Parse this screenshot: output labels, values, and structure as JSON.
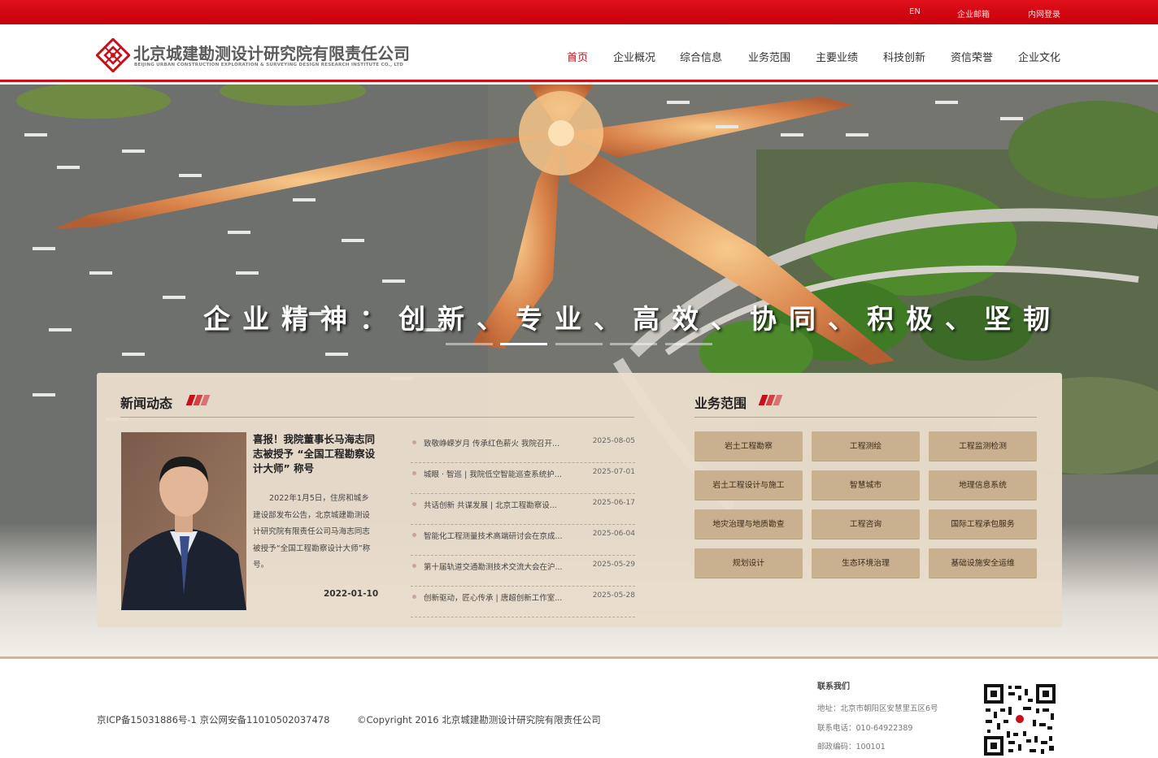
{
  "topbar": {
    "links": [
      "EN",
      "企业邮箱",
      "内网登录"
    ]
  },
  "header": {
    "logo_cn": "北京城建勘测设计研究院有限责任公司",
    "logo_en": "BEIJING URBAN CONSTRUCTION EXPLORATION & SURVEYING DESIGN RESEARCH INSTITUTE CO., LTD",
    "nav": [
      "首页",
      "企业概况",
      "综合信息",
      "业务范围",
      "主要业绩",
      "科技创新",
      "资信荣誉",
      "企业文化"
    ],
    "active_nav": "首页"
  },
  "banner": {
    "slogan": "企业精神：创新、专业、高效、协同、积极、坚韧",
    "slides_total": 5,
    "active_slide": 2
  },
  "news": {
    "title": "新闻动态",
    "featured": {
      "title": "喜报！我院董事长马海志同志被授予 “全国工程勘察设计大师” 称号",
      "body": "2022年1月5日，住房和城乡建设部发布公告，北京城建勘测设计研究院有限责任公司马海志同志被授予“全国工程勘察设计大师”称号。",
      "date": "2022-01-10"
    },
    "items": [
      {
        "text": "致敬峥嵘岁月 传承红色薪火 我院召开...",
        "date": "2025-08-05"
      },
      {
        "text": "城眼 · 智巡 | 我院低空智能巡查系统护...",
        "date": "2025-07-01"
      },
      {
        "text": "共话创新 共谋发展 | 北京工程勘察设...",
        "date": "2025-06-17"
      },
      {
        "text": "智能化工程测量技术高端研讨会在京成...",
        "date": "2025-06-04"
      },
      {
        "text": "第十届轨道交通勘测技术交流大会在沪...",
        "date": "2025-05-29"
      },
      {
        "text": "创新驱动，匠心传承 | 唐超创新工作室...",
        "date": "2025-05-28"
      }
    ]
  },
  "business": {
    "title": "业务范围",
    "items": [
      "岩土工程勘察",
      "工程测绘",
      "工程监测检测",
      "岩土工程设计与施工",
      "智慧城市",
      "地理信息系统",
      "地灾治理与地质勘查",
      "工程咨询",
      "国际工程承包服务",
      "规划设计",
      "生态环境治理",
      "基础设施安全运维"
    ]
  },
  "footer": {
    "icp": "京ICP备15031886号-1 京公网安备11010502037478",
    "copyright": "©Copyright 2016 北京城建勘测设计研究院有限责任公司",
    "contact_title": "联系我们",
    "address": "地址：北京市朝阳区安慧里五区6号",
    "phone": "联系电话：010-64922389",
    "postcode": "邮政编码：100101"
  },
  "colors": {
    "brand_red": "#c8101a",
    "panel_bg": "#e8ddcb",
    "button_bg": "#c9b08e"
  }
}
